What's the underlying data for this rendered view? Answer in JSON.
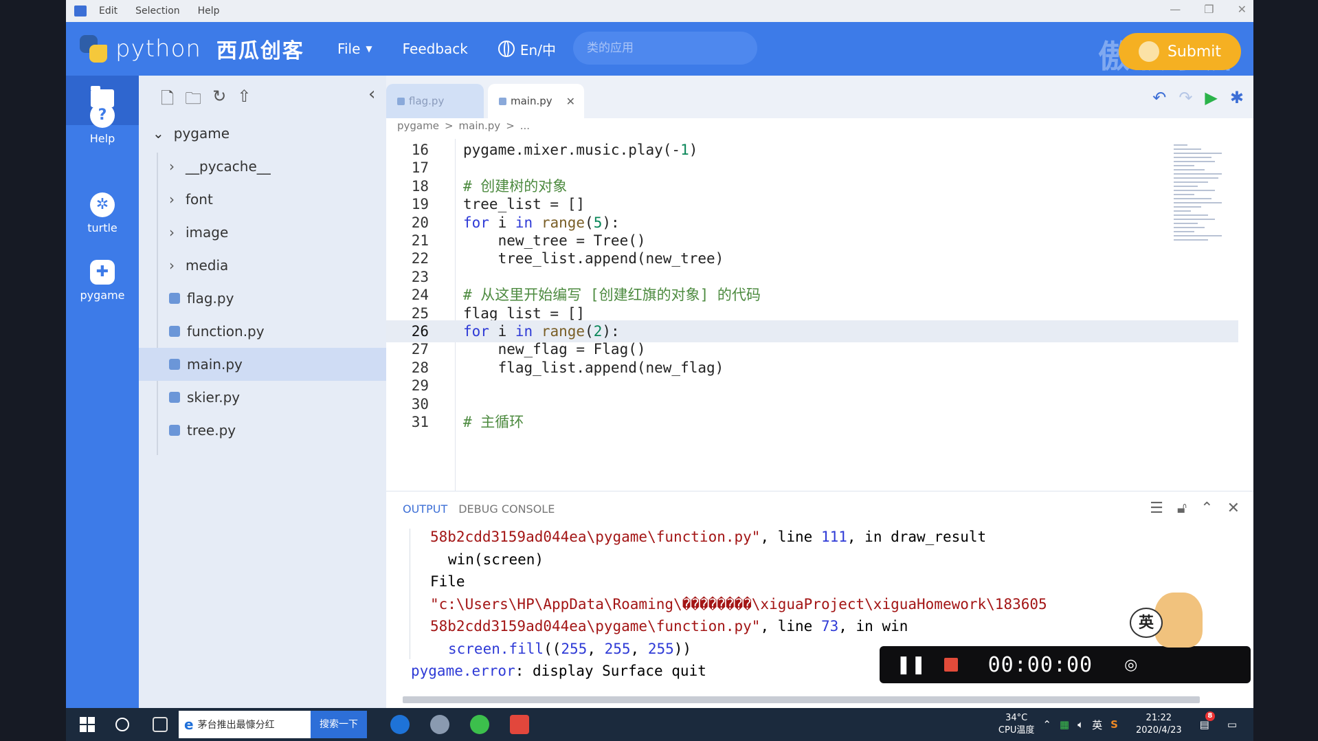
{
  "menubar": {
    "items": [
      "Edit",
      "Selection",
      "Help"
    ]
  },
  "header": {
    "brand": "python",
    "brand_cn": "西瓜创客",
    "nav": {
      "file": "File",
      "feedback": "Feedback",
      "lang": "En/中"
    },
    "search_placeholder": "类的应用",
    "submit": "Submit",
    "watermark": "傲软录屏"
  },
  "rail": {
    "help": "Help",
    "turtle": "turtle",
    "pygame": "pygame"
  },
  "explorer": {
    "root": "pygame",
    "items": [
      {
        "label": "__pycache__",
        "type": "folder"
      },
      {
        "label": "font",
        "type": "folder"
      },
      {
        "label": "image",
        "type": "folder"
      },
      {
        "label": "media",
        "type": "folder"
      },
      {
        "label": "flag.py",
        "type": "file"
      },
      {
        "label": "function.py",
        "type": "file"
      },
      {
        "label": "main.py",
        "type": "file",
        "selected": true
      },
      {
        "label": "skier.py",
        "type": "file"
      },
      {
        "label": "tree.py",
        "type": "file"
      }
    ]
  },
  "editor": {
    "tabs": [
      {
        "label": "flag.py"
      },
      {
        "label": "main.py",
        "active": true
      }
    ],
    "breadcrumb": [
      "pygame",
      ">",
      "main.py",
      ">",
      "..."
    ],
    "current_line": 26,
    "lines": [
      {
        "n": "16",
        "code": "pygame.mixer.music.play(-1)"
      },
      {
        "n": "17",
        "code": ""
      },
      {
        "n": "18",
        "code": "# 创建树的对象"
      },
      {
        "n": "19",
        "code": "tree_list = []"
      },
      {
        "n": "20",
        "code": "for i in range(5):"
      },
      {
        "n": "21",
        "code": "    new_tree = Tree()"
      },
      {
        "n": "22",
        "code": "    tree_list.append(new_tree)"
      },
      {
        "n": "23",
        "code": ""
      },
      {
        "n": "24",
        "code": "# 从这里开始编写 [创建红旗的对象] 的代码"
      },
      {
        "n": "25",
        "code": "flag_list = []"
      },
      {
        "n": "26",
        "code": "for i in range(2):"
      },
      {
        "n": "27",
        "code": "    new_flag = Flag()"
      },
      {
        "n": "28",
        "code": "    flag_list.append(new_flag)"
      },
      {
        "n": "29",
        "code": ""
      },
      {
        "n": "30",
        "code": ""
      },
      {
        "n": "31",
        "code": "# 主循环"
      }
    ]
  },
  "output": {
    "tabs": [
      "OUTPUT",
      "DEBUG CONSOLE"
    ],
    "lines": [
      "58b2cdd3159ad044ea\\pygame\\function.py\", line 111, in draw_result",
      "win(screen)",
      "File",
      "\"c:\\Users\\HP\\AppData\\Roaming\\��������\\xiguaProject\\xiguaHomework\\183605",
      "58b2cdd3159ad044ea\\pygame\\function.py\", line 73, in win",
      "screen.fill((255, 255, 255))",
      "pygame.error: display Surface quit"
    ]
  },
  "recorder": {
    "time": "00:00:00",
    "mascot_char": "英"
  },
  "taskbar": {
    "search_text": "茅台推出最慷分红",
    "search_button": "搜索一下",
    "temp": "34°C",
    "temp_label": "CPU温度",
    "ime": "英",
    "time": "21:22",
    "date": "2020/4/23",
    "notif_count": "8"
  }
}
